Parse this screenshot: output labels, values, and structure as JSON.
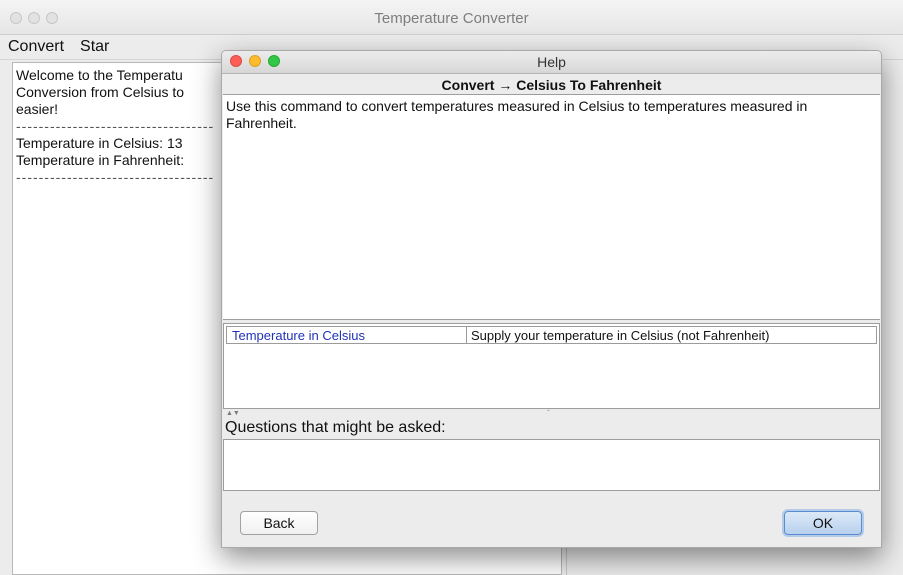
{
  "main_window": {
    "title": "Temperature Converter",
    "menu": [
      "Convert",
      "Star"
    ],
    "log_lines": [
      "Welcome to the Temperatu",
      "Conversion from Celsius to",
      "easier!",
      "Temperature in Celsius: 13",
      "Temperature in Fahrenheit:"
    ],
    "separator": "-----------------------------------"
  },
  "dialog": {
    "title": "Help",
    "command_heading": "Convert → Celsius To Fahrenheit",
    "description": "Use this command to convert temperatures measured in Celsius to temperatures measured in Fahrenheit.",
    "parameters": [
      {
        "name": "Temperature in Celsius",
        "description": "Supply your temperature in Celsius (not Fahrenheit)"
      }
    ],
    "splitter_arrows": "▲▼",
    "questions_label": "Questions that might be asked:",
    "back_button": "Back",
    "ok_button": "OK"
  },
  "colors": {
    "parameter_name": "#2232b7",
    "ok_button_accent": "#5a8bd1"
  }
}
